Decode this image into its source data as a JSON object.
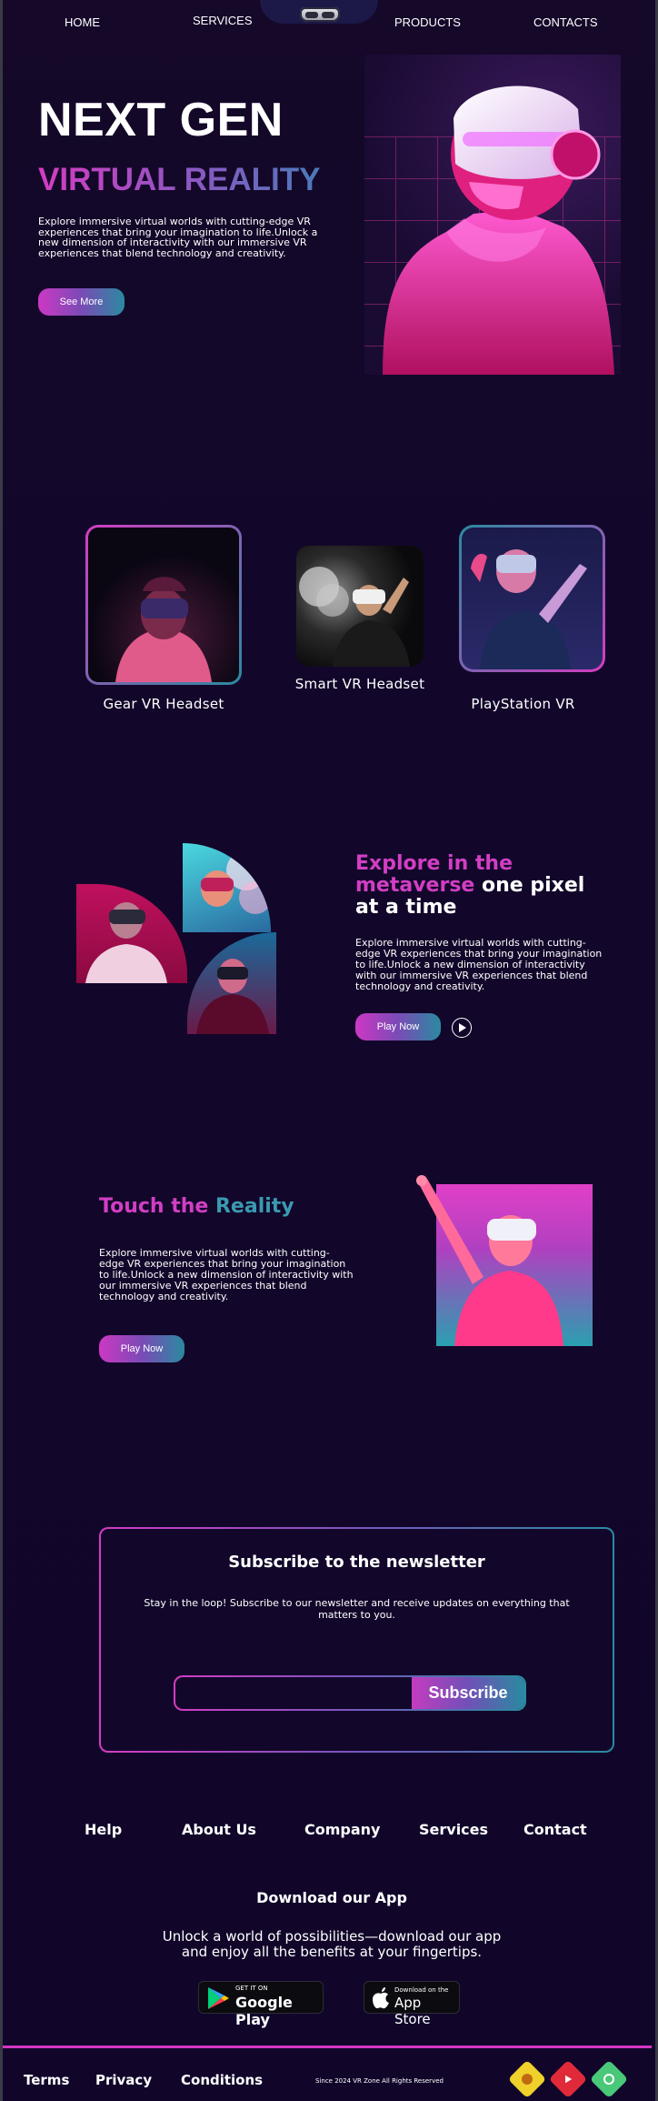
{
  "nav": {
    "items": [
      "HOME",
      "SERVICES",
      "PRODUCTS",
      "CONTACTS"
    ]
  },
  "hero": {
    "title": "NEXT GEN",
    "subtitle": "VIRTUAL REALITY",
    "description": "Explore immersive virtual worlds with cutting-edge VR experiences that bring your imagination to life.Unlock a new dimension of interactivity with our immersive VR experiences that blend technology and creativity.",
    "button": "See More"
  },
  "products": [
    {
      "label": "Gear VR Headset"
    },
    {
      "label": "Smart VR Headset"
    },
    {
      "label": "PlayStation  VR"
    }
  ],
  "explore": {
    "title_part1": "Explore in the",
    "title_part2": "metaverse",
    "title_part3": " one pixel",
    "title_part4": "at a time",
    "description": "Explore immersive virtual worlds with cutting-edge VR experiences that bring your imagination to life.Unlock a new dimension of interactivity with our immersive VR experiences that blend technology and creativity.",
    "button": "Play Now"
  },
  "touch": {
    "title_part1": "Touch the ",
    "title_part2": "Reality",
    "description": "Explore immersive virtual worlds with cutting-edge VR experiences that bring your imagination to life.Unlock a new dimension of interactivity with our immersive VR experiences that blend technology and creativity.",
    "button": "Play Now"
  },
  "newsletter": {
    "title": "Subscribe to the newsletter",
    "description": "Stay in the loop! Subscribe to our newsletter and receive updates on everything that matters to you.",
    "email_value": "",
    "button": "Subscribe"
  },
  "footer": {
    "links": [
      "Help",
      "About Us",
      "Company",
      "Services",
      "Contact"
    ],
    "download_title": "Download our App",
    "download_line1": "Unlock a world of possibilities—download our app",
    "download_line2": "and enjoy all the benefits at your fingertips.",
    "google_small": "GET IT ON",
    "google_big": "Google Play",
    "apple_small": "Download on the",
    "apple_big": "App Store",
    "bottom_links": [
      "Terms",
      "Privacy",
      "Conditions"
    ],
    "copyright": "Since 2024 VR Zone All Rights Reserved",
    "social_icons": [
      "yellow-diamond-icon",
      "youtube-icon",
      "green-diamond-icon"
    ]
  },
  "colors": {
    "background": "#12072a",
    "accent_pink": "#d43cc2",
    "accent_teal": "#2a8aa0"
  }
}
